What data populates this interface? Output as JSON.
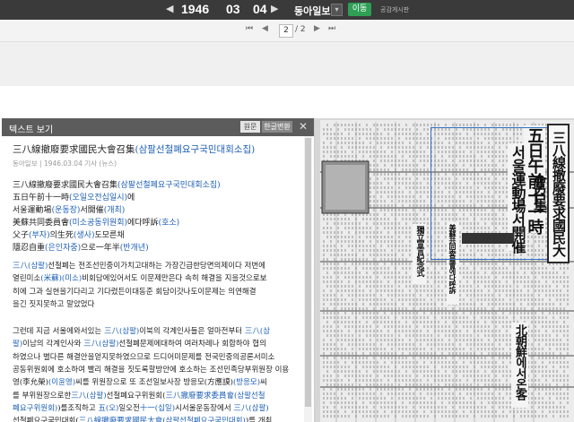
{
  "topbar": {
    "prev_icon": "triangle-left",
    "year": "1946",
    "month": "03",
    "day": "04",
    "next_icon": "triangle-right",
    "paper_name": "동아일보",
    "go_label": "이동",
    "notice_label": "공감게시판"
  },
  "pager": {
    "current": "2",
    "total": "/ 2"
  },
  "text_panel": {
    "title": "텍스트 보기",
    "original_label": "원문",
    "hangul_label": "한글변환",
    "close_icon": "close-icon",
    "article": {
      "title": "三八線撤廢要求國民大會召集(삼팔선철폐요구국민대회소집)",
      "source": "동아일보 | 1946.03.04 기사 (뉴스)",
      "lines": [
        [
          "三八線撤廢要求國民大會召集",
          "(삼팔선철폐요구국민대회소집)",
          ""
        ],
        [
          "五日午前十一時",
          "(오일오전십일시)",
          "에"
        ],
        [
          "서울運動場",
          "(운동장)",
          "서開催",
          "(개최)",
          ""
        ],
        [
          "美蘇共同委員會",
          "(미소공동위원회)",
          "에다呼訴",
          "(호소)",
          ""
        ],
        [
          "父子",
          "(부자)",
          "의生死",
          "(생사)",
          "도모른채"
        ],
        [
          "隱忍自重",
          "(은인자중)",
          "으로一年半",
          "(반개년)",
          ""
        ]
      ],
      "paragraph1": [
        [
          [
            "t",
            "三八(삼팔)"
          ],
          [
            "p",
            "선철폐는 전조선민중이가치고대하는 가장긴급한당면의제이다 저번에"
          ]
        ],
        [
          [
            "p",
            "열린미소"
          ],
          [
            "t",
            "(米蘇)(미소)"
          ],
          [
            "p",
            "비회담에있어서도 이문제만은다 속히 해결을 지을것으로보"
          ]
        ],
        [
          [
            "p",
            "히에 그과 실현을기다리고 기다렸든이대동준 회담이갓나도이문제는 의연해결"
          ]
        ],
        [
          [
            "p",
            "을긴 짓지못하고 말았었다"
          ]
        ]
      ],
      "paragraph2": [
        [
          [
            "p",
            "그런데 지금 서울에와서있는 "
          ],
          [
            "t",
            "三八(삼팔)"
          ],
          [
            "p",
            "이북의 각계인사들은 얼마전부터 "
          ],
          [
            "t",
            "三八(삼"
          ]
        ],
        [
          [
            "t",
            "팔)"
          ],
          [
            "p",
            "이남의 각계인사와 "
          ],
          [
            "t",
            "三八(삼팔)"
          ],
          [
            "p",
            "선철폐문제에대하여 여러차례나 회합하야 협의"
          ]
        ],
        [
          [
            "p",
            "하였으나 별다른 해결안을얻지못하였으므로 드디어미문제를 전국민중의공론서미소"
          ]
        ],
        [
          [
            "p",
            "공동위원회에 호소하여 빨리 해결을 짓도록할방안에 호소하는 조선민족당부위원장 이용"
          ]
        ],
        [
          [
            "p",
            "영(李允榮)"
          ],
          [
            "t",
            "(이윤영)"
          ],
          [
            "p",
            "씨를 위원장으로 또 조선일보사장 방응모(方應謨)"
          ],
          [
            "t",
            "(방응모)"
          ],
          [
            "p",
            "씨"
          ]
        ],
        [
          [
            "p",
            "를 부위원장으로한"
          ],
          [
            "t",
            "三八(삼팔)"
          ],
          [
            "p",
            "선철폐요구위원회("
          ],
          [
            "t",
            "三八撤廢要求委員會(삼팔선철"
          ]
        ],
        [
          [
            "t",
            "폐요구위원회)"
          ],
          [
            "p",
            ")를조직하고 "
          ],
          [
            "t",
            "五(오)"
          ],
          [
            "p",
            "일오전"
          ],
          [
            "t",
            "十一(십일)"
          ],
          [
            "p",
            "시서울운동장에서 "
          ],
          [
            "t",
            "三八(삼팔)"
          ]
        ],
        [
          [
            "p",
            "선철폐요구국민대회("
          ],
          [
            "t",
            "三八線撤廢要求國民大會(삼팔선철폐요구국민대회)"
          ],
          [
            "p",
            ")를 개최"
          ]
        ],
        [
          [
            "p",
            "하게되었다"
          ]
        ]
      ]
    }
  },
  "newspaper": {
    "headline": "三八線撤廢要求國民大會召集",
    "sub1": "五日午前十一時",
    "sub2": "서울運動場서開催",
    "column_texts": [
      "父子의生死도모른채",
      "隱忍自重으로一年半",
      "美蘇共同委員會에다呼訴",
      "解放으로豫測",
      "獨立宣言紀念式",
      "北朝鮮에서온客"
    ]
  }
}
